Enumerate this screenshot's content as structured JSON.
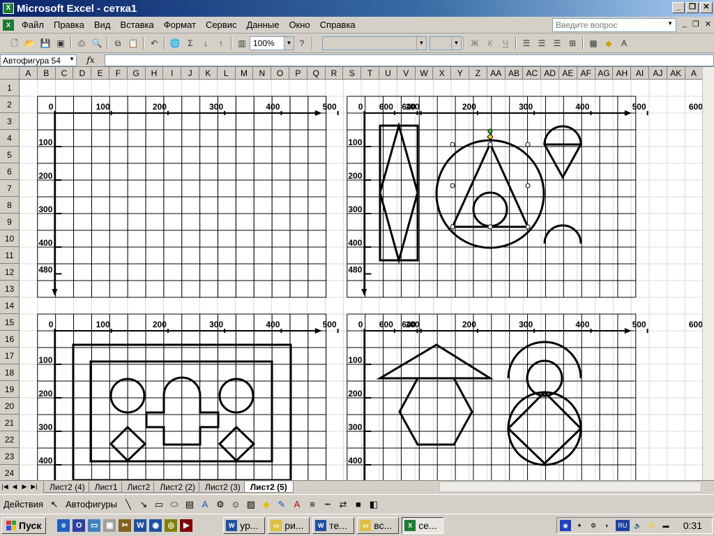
{
  "window": {
    "title": "Microsoft Excel - сетка1",
    "icon": "excel-icon"
  },
  "menu": {
    "items": [
      "Файл",
      "Правка",
      "Вид",
      "Вставка",
      "Формат",
      "Сервис",
      "Данные",
      "Окно",
      "Справка"
    ],
    "ask_placeholder": "Введите вопрос"
  },
  "toolbar": {
    "zoom": "100%",
    "font_bold": "Ж",
    "font_italic": "К",
    "font_underline": "Ч"
  },
  "formula_bar": {
    "name_box": "Автофигура 54",
    "fx": "fx",
    "content": ""
  },
  "columns": [
    "A",
    "B",
    "C",
    "D",
    "E",
    "F",
    "G",
    "H",
    "I",
    "J",
    "K",
    "L",
    "M",
    "N",
    "O",
    "P",
    "Q",
    "R",
    "S",
    "T",
    "U",
    "V",
    "W",
    "X",
    "Y",
    "Z",
    "AA",
    "AB",
    "AC",
    "AD",
    "AE",
    "AF",
    "AG",
    "AH",
    "AI",
    "AJ",
    "AK",
    "A"
  ],
  "rows": [
    "1",
    "2",
    "3",
    "4",
    "5",
    "6",
    "7",
    "8",
    "9",
    "10",
    "11",
    "12",
    "13",
    "14",
    "15",
    "16",
    "17",
    "18",
    "19",
    "20",
    "21",
    "22",
    "23",
    "24"
  ],
  "axis_labels": {
    "x": [
      "0",
      "100",
      "200",
      "300",
      "400",
      "500",
      "600",
      "640"
    ],
    "y": [
      "100",
      "200",
      "300",
      "400",
      "480"
    ],
    "y_short": [
      "100",
      "200",
      "300",
      "400"
    ]
  },
  "sheet_tabs": [
    "Лист2 (4)",
    "Лист1",
    "Лист2",
    "Лист2 (2)",
    "Лист2 (3)",
    "Лист2 (5)"
  ],
  "active_tab": "Лист2 (5)",
  "drawing": {
    "actions": "Действия",
    "autoshapes": "Автофигуры"
  },
  "taskbar": {
    "start": "Пуск",
    "tasks": [
      {
        "icon": "word-icon",
        "label": "ур..."
      },
      {
        "icon": "folder-icon",
        "label": "ри..."
      },
      {
        "icon": "word-icon",
        "label": "те..."
      },
      {
        "icon": "folder-icon",
        "label": "вс..."
      },
      {
        "icon": "excel-icon",
        "label": "се..."
      }
    ],
    "lang": "RU",
    "clock": "0:31"
  }
}
